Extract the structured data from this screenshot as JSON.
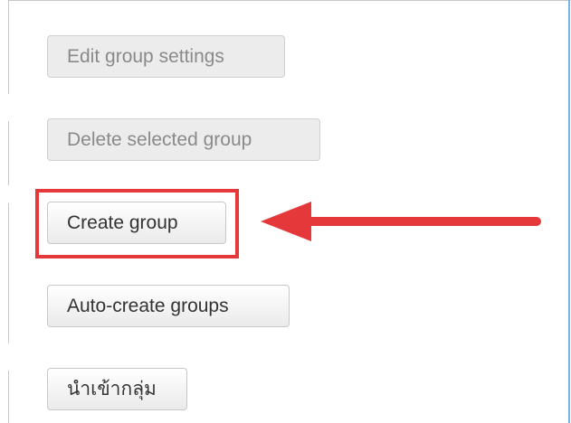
{
  "group_actions": {
    "edit_settings_label": "Edit group settings",
    "delete_selected_label": "Delete selected group",
    "create_label": "Create group",
    "auto_create_label": "Auto-create groups",
    "import_label": "นำเข้ากลุ่ม"
  },
  "annotation": {
    "highlight_color": "#e5383b",
    "arrow_color": "#e5383b",
    "highlighted_target": "Create group"
  },
  "colors": {
    "frame_border": "#c6c9cc",
    "frame_right_border": "#7eb2e2",
    "disabled_button_bg": "#ececec",
    "disabled_text": "#8a8a8a"
  }
}
